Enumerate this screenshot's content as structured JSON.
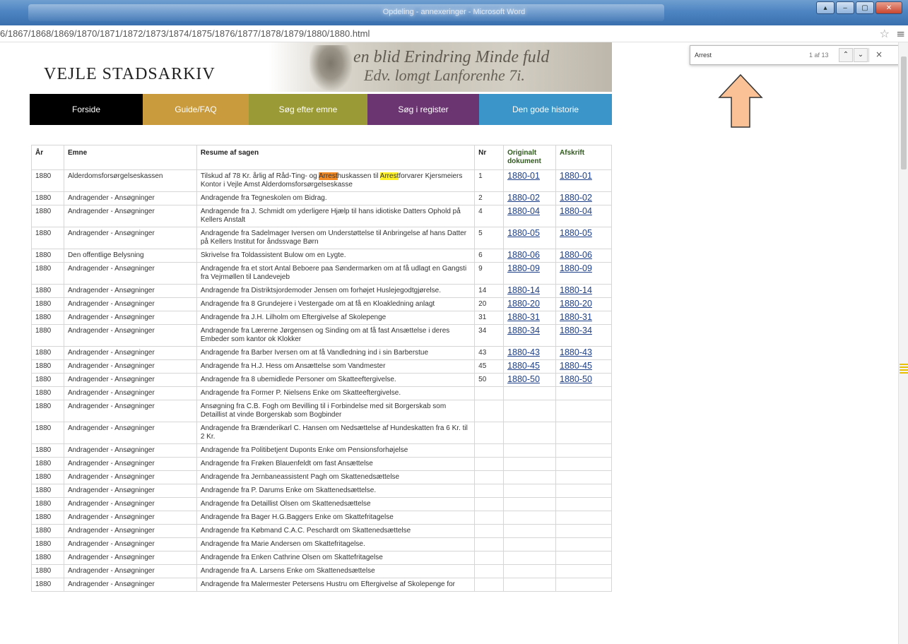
{
  "window": {
    "title": "Opdeling - annexeringer - Microsoft Word",
    "minimize_glyph": "‒",
    "maximize_glyph": "▢",
    "close_glyph": "✕",
    "extra_glyph": "▴"
  },
  "browser": {
    "url": "6/1867/1868/1869/1870/1871/1872/1873/1874/1875/1876/1877/1878/1879/1880/1880.html",
    "star_glyph": "☆",
    "menu_glyph": "≡"
  },
  "find_bar": {
    "query": "Arrest",
    "match_count": "1 af 13",
    "prev_glyph": "⌃",
    "next_glyph": "⌄",
    "close_glyph": "×"
  },
  "site": {
    "title": "VEJLE STADSARKIV",
    "header_script_line1": "en blid Erindring Minde fuld",
    "header_script_line2": "Edv. lomgt Lanforenhe 7i."
  },
  "nav": [
    {
      "label": "Forside",
      "color": "#000000",
      "width": 160
    },
    {
      "label": "Guide/FAQ",
      "color": "#c99b3c",
      "width": 150
    },
    {
      "label": "Søg efter emne",
      "color": "#9a9a36",
      "width": 168
    },
    {
      "label": "Søg i register",
      "color": "#6a3570",
      "width": 158
    },
    {
      "label": "Den gode historie",
      "color": "#3b95c8",
      "width": 188
    }
  ],
  "table": {
    "headers": {
      "year": "År",
      "subject": "Emne",
      "summary": "Resume af sagen",
      "nr": "Nr",
      "original": "Originalt dokument",
      "transcript": "Afskrift"
    },
    "first_row": {
      "year": "1880",
      "subject": "Alderdomsforsørgelseskassen",
      "summary_part1": "Tilskud af 78 Kr. årlig af Råd-Ting- og ",
      "match1": "Arrest",
      "summary_part2": "huskassen til ",
      "match2": "Arrest",
      "summary_part3": "forvarer Kjersmeiers Kontor i Vejle Amst Alderdomsforsørgelseskasse",
      "nr": "1",
      "original": "1880-01",
      "transcript": "1880-01"
    },
    "rows": [
      {
        "year": "1880",
        "subject": "Andragender - Ansøgninger",
        "summary": "Andragende fra Tegneskolen om Bidrag.",
        "nr": "2",
        "original": "1880-02",
        "transcript": "1880-02"
      },
      {
        "year": "1880",
        "subject": "Andragender - Ansøgninger",
        "summary": "Andragende fra J. Schmidt om yderligere Hjælp til hans idiotiske Datters Ophold på Kellers Anstalt",
        "nr": "4",
        "original": "1880-04",
        "transcript": "1880-04"
      },
      {
        "year": "1880",
        "subject": "Andragender - Ansøgninger",
        "summary": "Andragende fra Sadelmager Iversen om Understøttelse til Anbringelse af hans Datter på Kellers Institut for åndssvage Børn",
        "nr": "5",
        "original": "1880-05",
        "transcript": "1880-05"
      },
      {
        "year": "1880",
        "subject": "Den offentlige Belysning",
        "summary": "Skrivelse fra Toldassistent Bulow om en Lygte.",
        "nr": "6",
        "original": "1880-06",
        "transcript": "1880-06"
      },
      {
        "year": "1880",
        "subject": "Andragender - Ansøgninger",
        "summary": "Andragende fra et stort Antal Beboere paa Søndermarken om at få udlagt en Gangsti fra Vejrmøllen til Landevejeb",
        "nr": "9",
        "original": "1880-09",
        "transcript": "1880-09"
      },
      {
        "year": "1880",
        "subject": "Andragender - Ansøgninger",
        "summary": "Andragende fra Distriktsjordemoder Jensen om forhøjet Huslejegodtgjørelse.",
        "nr": "14",
        "original": "1880-14",
        "transcript": "1880-14"
      },
      {
        "year": "1880",
        "subject": "Andragender - Ansøgninger",
        "summary": "Andragende fra 8 Grundejere i Vestergade om at få en Kloakledning anlagt",
        "nr": "20",
        "original": "1880-20",
        "transcript": "1880-20"
      },
      {
        "year": "1880",
        "subject": "Andragender - Ansøgninger",
        "summary": "Andragende fra J.H. Lilholm om Eftergivelse af Skolepenge",
        "nr": "31",
        "original": "1880-31",
        "transcript": "1880-31"
      },
      {
        "year": "1880",
        "subject": "Andragender - Ansøgninger",
        "summary": "Andragende fra Lærerne Jørgensen og Sinding om at få fast Ansættelse i deres Embeder som kantor ok Klokker",
        "nr": "34",
        "original": "1880-34",
        "transcript": "1880-34"
      },
      {
        "year": "1880",
        "subject": "Andragender - Ansøgninger",
        "summary": "Andragende fra Barber Iversen om at få Vandledning ind i sin Barberstue",
        "nr": "43",
        "original": "1880-43",
        "transcript": "1880-43"
      },
      {
        "year": "1880",
        "subject": "Andragender - Ansøgninger",
        "summary": "Andragende fra H.J. Hess om Ansættelse som Vandmester",
        "nr": "45",
        "original": "1880-45",
        "transcript": "1880-45"
      },
      {
        "year": "1880",
        "subject": "Andragender - Ansøgninger",
        "summary": "Andragende fra 8 ubemidlede Personer om Skatteeftergivelse.",
        "nr": "50",
        "original": "1880-50",
        "transcript": "1880-50"
      },
      {
        "year": "1880",
        "subject": "Andragender - Ansøgninger",
        "summary": "Andragende fra Former P. Nielsens Enke om Skatteeftergivelse.",
        "nr": "",
        "original": "",
        "transcript": ""
      },
      {
        "year": "1880",
        "subject": "Andragender - Ansøgninger",
        "summary": "Ansøgning fra C.B. Fogh om Bevilling til i Forbindelse med sit Borgerskab som Detaillist at vinde Borgerskab som Bogbinder",
        "nr": "",
        "original": "",
        "transcript": ""
      },
      {
        "year": "1880",
        "subject": "Andragender - Ansøgninger",
        "summary": "Andragende fra Brænderikarl C. Hansen om Nedsættelse af Hundeskatten fra 6 Kr. til 2 Kr.",
        "nr": "",
        "original": "",
        "transcript": ""
      },
      {
        "year": "1880",
        "subject": "Andragender - Ansøgninger",
        "summary": "Andragende fra Politibetjent Duponts Enke om Pensionsforhøjelse",
        "nr": "",
        "original": "",
        "transcript": ""
      },
      {
        "year": "1880",
        "subject": "Andragender - Ansøgninger",
        "summary": "Andragende fra Frøken Blauenfeldt om fast Ansættelse",
        "nr": "",
        "original": "",
        "transcript": ""
      },
      {
        "year": "1880",
        "subject": "Andragender - Ansøgninger",
        "summary": "Andragende fra Jernbaneassistent Pagh om Skattenedsættelse",
        "nr": "",
        "original": "",
        "transcript": ""
      },
      {
        "year": "1880",
        "subject": "Andragender - Ansøgninger",
        "summary": "Andragende fra P. Darums Enke om Skattenedsættelse.",
        "nr": "",
        "original": "",
        "transcript": ""
      },
      {
        "year": "1880",
        "subject": "Andragender - Ansøgninger",
        "summary": "Andragende fra Detaillist Olsen om Skattenedsættelse",
        "nr": "",
        "original": "",
        "transcript": ""
      },
      {
        "year": "1880",
        "subject": "Andragender - Ansøgninger",
        "summary": "Andragende fra Bager H.G.Baggers Enke om Skattefritagelse",
        "nr": "",
        "original": "",
        "transcript": ""
      },
      {
        "year": "1880",
        "subject": "Andragender - Ansøgninger",
        "summary": "Andragende fra Købmand C.A.C. Peschardt om Skattenedsættelse",
        "nr": "",
        "original": "",
        "transcript": ""
      },
      {
        "year": "1880",
        "subject": "Andragender - Ansøgninger",
        "summary": "Andragende fra Marie Andersen om Skattefritagelse.",
        "nr": "",
        "original": "",
        "transcript": ""
      },
      {
        "year": "1880",
        "subject": "Andragender - Ansøgninger",
        "summary": "Andragende fra Enken Cathrine Olsen om Skattefritagelse",
        "nr": "",
        "original": "",
        "transcript": ""
      },
      {
        "year": "1880",
        "subject": "Andragender - Ansøgninger",
        "summary": "Andragende fra A. Larsens Enke om Skattenedsættelse",
        "nr": "",
        "original": "",
        "transcript": ""
      },
      {
        "year": "1880",
        "subject": "Andragender - Ansøgninger",
        "summary": "Andragende fra Malermester Petersens Hustru om Eftergivelse af Skolepenge for",
        "nr": "",
        "original": "",
        "transcript": ""
      }
    ]
  },
  "colors": {
    "highlight_current": "#f28a25",
    "highlight_other": "#fff22a",
    "arrow_fill": "#f9c195",
    "link": "#1d3f87"
  }
}
